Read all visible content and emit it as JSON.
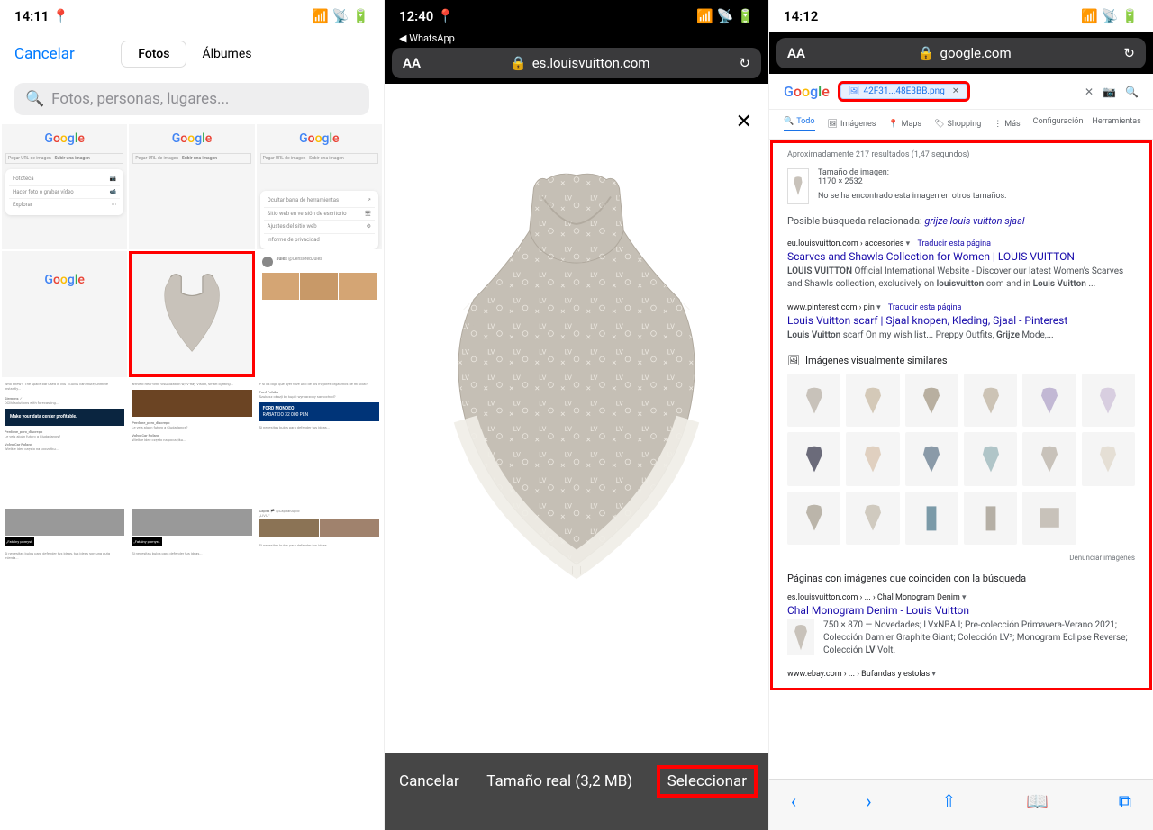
{
  "phone1": {
    "status": {
      "time": "14:11",
      "location_arrow": "↗"
    },
    "cancel": "Cancelar",
    "tabs": {
      "photos": "Fotos",
      "albums": "Álbumes"
    },
    "search_placeholder": "Fotos, personas, lugares...",
    "grid_labels": {
      "google": "Google",
      "upload_option1": "Pegar URL de imagen",
      "upload_option2": "Subir una imagen",
      "menu_fototeca": "Fototeca",
      "menu_hacer_foto": "Hacer foto o grabar vídeo",
      "menu_explorar": "Explorar",
      "menu_ocultar": "Ocultar barra de herramientas",
      "menu_escritorio": "Sitio web en versión de escritorio",
      "menu_ajustes": "Ajustes del sitio web",
      "menu_privacidad": "Informe de privacidad"
    }
  },
  "phone2": {
    "status": {
      "time": "12:40",
      "back_app": "WhatsApp"
    },
    "url_aa": "AA",
    "url": "es.louisvuitton.com",
    "toolbar": {
      "cancel": "Cancelar",
      "size": "Tamaño real (3,2 MB)",
      "select": "Seleccionar"
    }
  },
  "phone3": {
    "status": {
      "time": "14:12"
    },
    "url_aa": "AA",
    "url": "google.com",
    "google_logo": "Google",
    "search_chip": "42F31...48E3BB.png",
    "tabs": {
      "all": "Todo",
      "images": "Imágenes",
      "maps": "Maps",
      "shopping": "Shopping",
      "more": "Más",
      "config": "Configuración",
      "tools": "Herramientas"
    },
    "results_count": "Aproximadamente 217 resultados (1,47 segundos)",
    "image_info": {
      "label": "Tamaño de imagen:",
      "dims": "1170 × 2532",
      "note": "No se ha encontrado esta imagen en otros tamaños."
    },
    "related": {
      "prefix": "Posible búsqueda relacionada: ",
      "link": "grijze louis vuitton sjaal"
    },
    "results": [
      {
        "url": "eu.louisvuitton.com › accesories",
        "translate": "Traducir esta página",
        "title": "Scarves and Shawls Collection for Women | LOUIS VUITTON",
        "snippet_prefix": "LOUIS VUITTON",
        "snippet": " Official International Website - Discover our latest Women's Scarves and Shawls collection, exclusively on ",
        "snippet_bold2": "louisvuitton",
        "snippet_tail": ".com and in ",
        "snippet_bold3": "Louis Vuitton",
        "snippet_end": " ..."
      },
      {
        "url": "www.pinterest.com › pin",
        "translate": "Traducir esta página",
        "title": "Louis Vuitton scarf | Sjaal knopen, Kleding, Sjaal - Pinterest",
        "snippet_prefix": "Louis Vuitton",
        "snippet": " scarf On my wish list... Preppy Outfits, ",
        "snippet_bold2": "Grijze",
        "snippet_tail": " Mode,..."
      }
    ],
    "visual_similar": "Imágenes visualmente similares",
    "report_images": "Denunciar imágenes",
    "matching_pages": "Páginas con imágenes que coinciden con la búsqueda",
    "match": {
      "url": "es.louisvuitton.com › ... › Chal Monogram Denim",
      "title": "Chal Monogram Denim - Louis Vuitton",
      "dims": "750 × 870 — ",
      "snippet": "Novedades; LVxNBA I; Pre-colección Primavera-Verano 2021; Colección Damier Graphite Giant; Colección LV²; Monogram Eclipse Reverse; Colección ",
      "snippet_bold": "LV",
      "snippet_end": " Volt."
    },
    "ebay_url": "www.ebay.com › ... › Bufandas y estolas"
  },
  "scarf_colors": {
    "main": "#C8C2BA",
    "light": "#E8E5E0",
    "accent": "#F5F3F0"
  }
}
